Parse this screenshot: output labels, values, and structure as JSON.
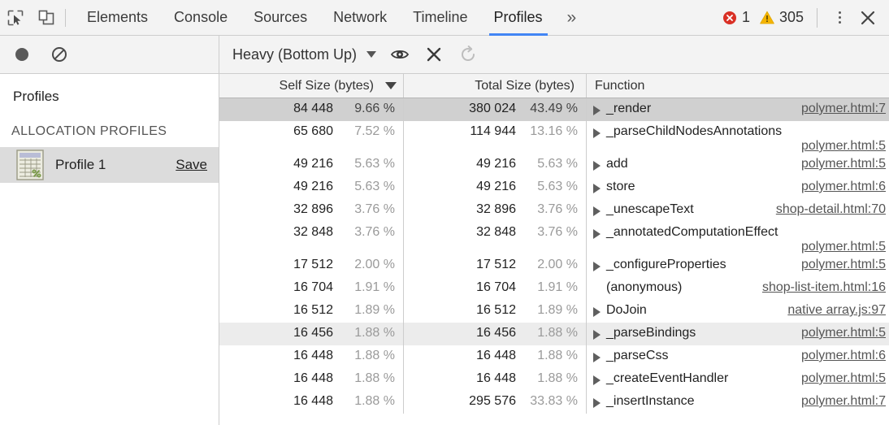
{
  "window": {
    "tabs": [
      {
        "label": "Elements",
        "selected": false
      },
      {
        "label": "Console",
        "selected": false
      },
      {
        "label": "Sources",
        "selected": false
      },
      {
        "label": "Network",
        "selected": false
      },
      {
        "label": "Timeline",
        "selected": false
      },
      {
        "label": "Profiles",
        "selected": true
      }
    ],
    "more_label": "»",
    "error_count": "1",
    "warning_count": "305",
    "accent_color": "#4285f4",
    "error_color": "#d93025",
    "warning_color": "#f5b400",
    "inspect_icon": "inspect-element-icon",
    "device_icon": "device-toolbar-icon",
    "menu_icon": "more-options-icon",
    "close_icon": "close-devtools-icon"
  },
  "sidebar": {
    "toolbar": {
      "record_label": "record-button",
      "clear_label": "clear-all-profiles-button"
    },
    "title": "Profiles",
    "section_label": "ALLOCATION PROFILES",
    "items": [
      {
        "label": "Profile 1",
        "action": "Save",
        "icon": "profile-sheet-icon",
        "selected": true
      }
    ]
  },
  "main": {
    "toolbar": {
      "view_mode": "Heavy (Bottom Up)",
      "focus_label": "focus-selected-function-button",
      "exclude_label": "exclude-selected-function-button",
      "restore_label": "restore-all-functions-button"
    },
    "columns": [
      {
        "key": "self",
        "label": "Self Size (bytes)",
        "sorted": true,
        "sort_dir": "desc"
      },
      {
        "key": "total",
        "label": "Total Size (bytes)",
        "sorted": false
      },
      {
        "key": "function",
        "label": "Function",
        "sorted": false
      }
    ],
    "rows": [
      {
        "self": "84 448",
        "self_pct": "9.66 %",
        "total": "380 024",
        "total_pct": "43.49 %",
        "fn": "_render",
        "url": "polymer.html:7",
        "expandable": true,
        "state": "selected",
        "wrap": false
      },
      {
        "self": "65 680",
        "self_pct": "7.52 %",
        "total": "114 944",
        "total_pct": "13.16 %",
        "fn": "_parseChildNodesAnnotations",
        "url": "polymer.html:5",
        "expandable": true,
        "state": "none",
        "wrap": true
      },
      {
        "self": "49 216",
        "self_pct": "5.63 %",
        "total": "49 216",
        "total_pct": "5.63 %",
        "fn": "add",
        "url": "polymer.html:5",
        "expandable": true,
        "state": "none",
        "wrap": false
      },
      {
        "self": "49 216",
        "self_pct": "5.63 %",
        "total": "49 216",
        "total_pct": "5.63 %",
        "fn": "store",
        "url": "polymer.html:6",
        "expandable": true,
        "state": "none",
        "wrap": false
      },
      {
        "self": "32 896",
        "self_pct": "3.76 %",
        "total": "32 896",
        "total_pct": "3.76 %",
        "fn": "_unescapeText",
        "url": "shop-detail.html:70",
        "expandable": true,
        "state": "none",
        "wrap": false
      },
      {
        "self": "32 848",
        "self_pct": "3.76 %",
        "total": "32 848",
        "total_pct": "3.76 %",
        "fn": "_annotatedComputationEffect",
        "url": "polymer.html:5",
        "expandable": true,
        "state": "none",
        "wrap": true
      },
      {
        "self": "17 512",
        "self_pct": "2.00 %",
        "total": "17 512",
        "total_pct": "2.00 %",
        "fn": "_configureProperties",
        "url": "polymer.html:5",
        "expandable": true,
        "state": "none",
        "wrap": false
      },
      {
        "self": "16 704",
        "self_pct": "1.91 %",
        "total": "16 704",
        "total_pct": "1.91 %",
        "fn": "(anonymous)",
        "url": "shop-list-item.html:16",
        "expandable": false,
        "state": "none",
        "wrap": false
      },
      {
        "self": "16 512",
        "self_pct": "1.89 %",
        "total": "16 512",
        "total_pct": "1.89 %",
        "fn": "DoJoin",
        "url": "native array.js:97",
        "expandable": true,
        "state": "none",
        "wrap": false
      },
      {
        "self": "16 456",
        "self_pct": "1.88 %",
        "total": "16 456",
        "total_pct": "1.88 %",
        "fn": "_parseBindings",
        "url": "polymer.html:5",
        "expandable": true,
        "state": "hover",
        "wrap": false
      },
      {
        "self": "16 448",
        "self_pct": "1.88 %",
        "total": "16 448",
        "total_pct": "1.88 %",
        "fn": "_parseCss",
        "url": "polymer.html:6",
        "expandable": true,
        "state": "none",
        "wrap": false
      },
      {
        "self": "16 448",
        "self_pct": "1.88 %",
        "total": "16 448",
        "total_pct": "1.88 %",
        "fn": "_createEventHandler",
        "url": "polymer.html:5",
        "expandable": true,
        "state": "none",
        "wrap": false
      },
      {
        "self": "16 448",
        "self_pct": "1.88 %",
        "total": "295 576",
        "total_pct": "33.83 %",
        "fn": "_insertInstance",
        "url": "polymer.html:7",
        "expandable": true,
        "state": "none",
        "wrap": false
      }
    ]
  }
}
